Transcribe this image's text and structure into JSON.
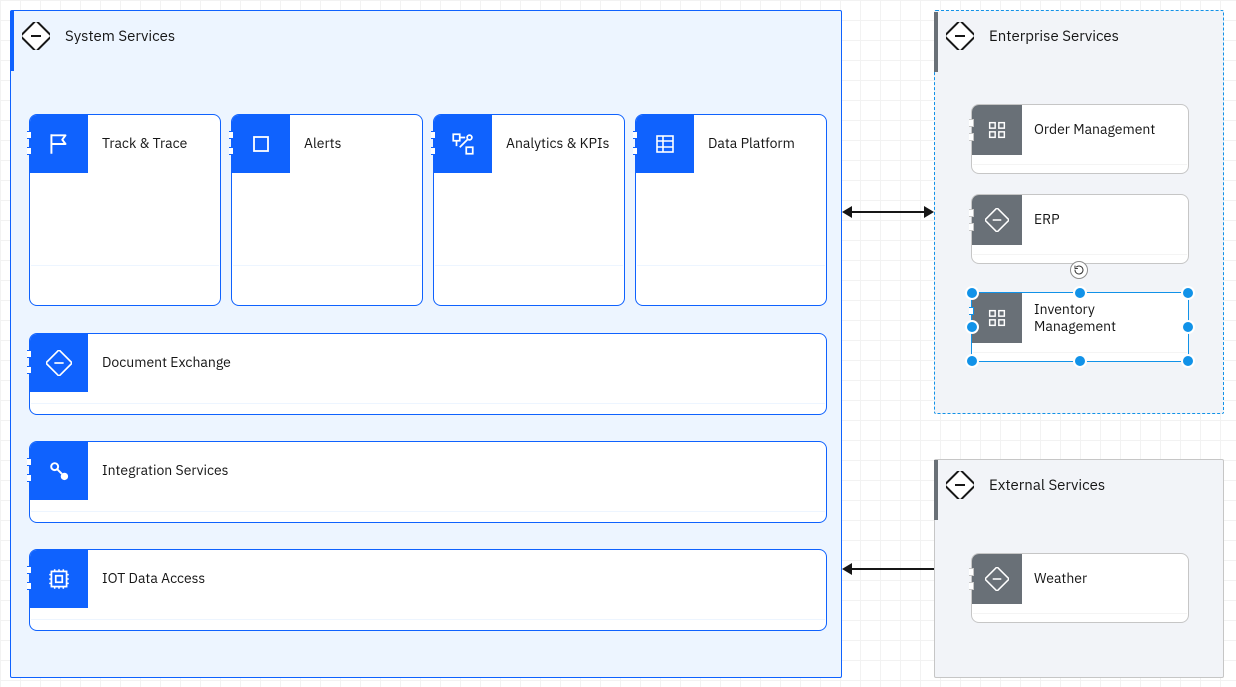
{
  "system_services": {
    "title": "System Services",
    "cards": {
      "track_trace": "Track & Trace",
      "alerts": "Alerts",
      "analytics": "Analytics & KPIs",
      "data_platform": "Data Platform"
    },
    "bars": {
      "doc_exchange": "Document Exchange",
      "integration": "Integration Services",
      "iot": "IOT Data Access"
    }
  },
  "enterprise_services": {
    "title": "Enterprise Services",
    "cards": {
      "order_mgmt": "Order Management",
      "erp": "ERP",
      "inventory": "Inventory Management"
    }
  },
  "external_services": {
    "title": "External Services",
    "cards": {
      "weather": "Weather"
    }
  },
  "colors": {
    "blue": "#0f62fe",
    "gray": "#697077",
    "select": "#1192e8"
  }
}
